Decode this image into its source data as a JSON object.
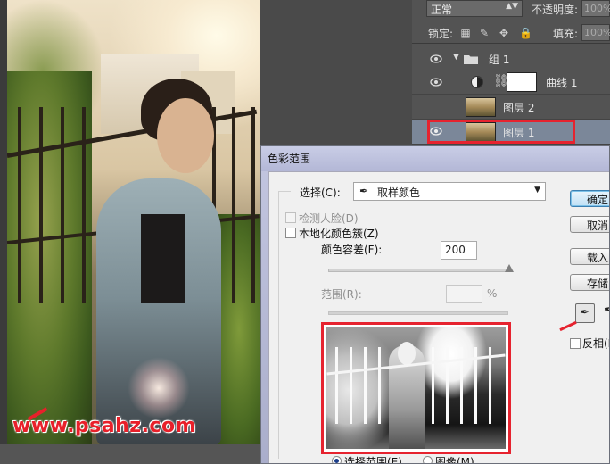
{
  "watermark": "www.psahz.com",
  "layers_panel": {
    "blend_mode": "正常",
    "opacity_label": "不透明度:",
    "opacity_value": "100%",
    "lock_label": "锁定:",
    "fill_label": "填充:",
    "fill_value": "100%",
    "layers": [
      {
        "name": "组 1",
        "type": "group"
      },
      {
        "name": "曲线 1",
        "type": "curves-adjustment"
      },
      {
        "name": "图层 2",
        "type": "pixel"
      },
      {
        "name": "图层 1",
        "type": "pixel",
        "selected": true
      }
    ]
  },
  "dialog": {
    "title": "色彩范围",
    "select_label": "选择(C):",
    "select_value": "取样颜色",
    "detect_faces_label": "检测人脸(D)",
    "localized_clusters_label": "本地化颜色簇(Z)",
    "fuzziness_label": "颜色容差(F):",
    "fuzziness_value": "200",
    "range_label": "范围(R):",
    "range_unit": "%",
    "range_value": "",
    "view_options": [
      "选择范围(E)",
      "图像(M)"
    ],
    "view_selected": "选择范围(E)",
    "buttons": {
      "ok": "确定",
      "cancel": "取消",
      "load": "载入(L)...",
      "save": "存储(S)..."
    },
    "invert_label": "反相(I)"
  },
  "colors": {
    "highlight": "#e6232f",
    "dialog_title_bg": "#b3b7d6",
    "panel_bg": "#535353",
    "selected_layer": "#7b8799"
  }
}
